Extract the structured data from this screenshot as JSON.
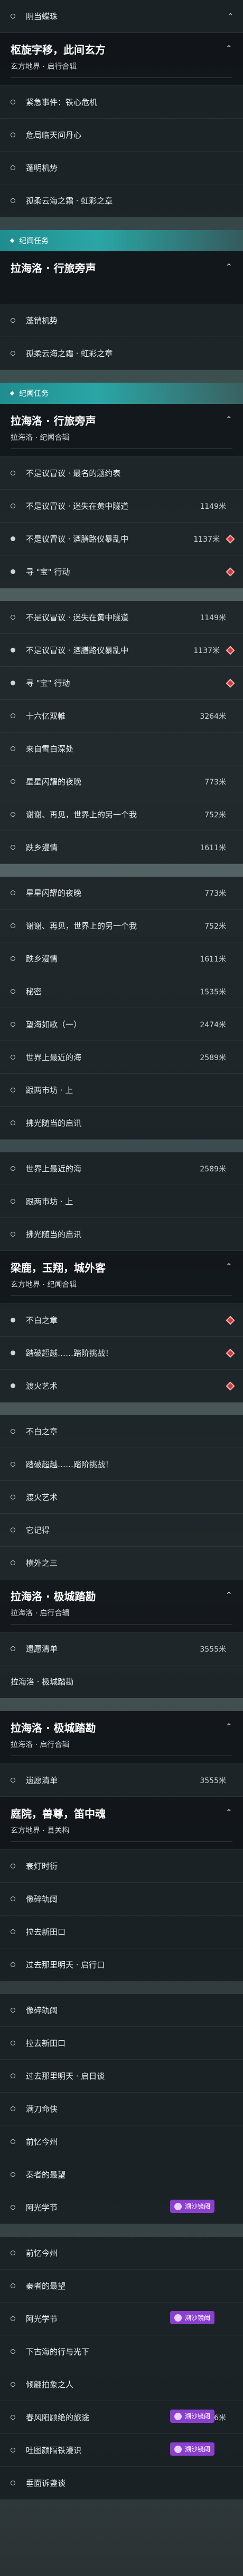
{
  "colors": {
    "accent": "#2aa6a6",
    "badge": "#8b3fd1",
    "marker_red": "#d23a3a"
  },
  "section1": {
    "rows": [
      {
        "label": "阴当蝶珠",
        "icon": "dot",
        "chevron": "collapse"
      }
    ],
    "header": {
      "title": "枢旋字移，此间玄方",
      "sub": "玄方地界 · 启行合辑"
    },
    "rows2": [
      {
        "label": "紧急事件：铁心危机",
        "icon": "dot"
      },
      {
        "label": "危局临天问丹心",
        "icon": "dot"
      },
      {
        "label": "蓬明机势",
        "icon": "dot"
      },
      {
        "label": "孤柔云海之霜 · 虹彩之章",
        "icon": "dot"
      }
    ]
  },
  "tag1": "纪闻任务",
  "section2": {
    "header": {
      "title": "拉海洛 · 行旅旁声",
      "sub": ""
    },
    "rows": [
      {
        "label": "蓬销机势",
        "icon": "dot"
      },
      {
        "label": "孤柔云海之霜 · 虹彩之章",
        "icon": "dot"
      }
    ]
  },
  "tag2": "纪闻任务",
  "section3": {
    "header": {
      "title": "拉海洛 · 行旅旁声",
      "sub": "拉海洛 · 纪闻合辑"
    },
    "rows": [
      {
        "label": "不是议冒议 · 最名的题约表",
        "icon": "dot",
        "dist": "",
        "red": false
      },
      {
        "label": "不是议冒议 · 迷失在黄中隧道",
        "icon": "dot",
        "dist": "1149米",
        "red": false
      },
      {
        "label": "不是议冒议 · 酒膳路仪暴乱中",
        "icon": "dot",
        "dist": "1137米",
        "red": true
      },
      {
        "label": "寻 \"宝\" 行动",
        "icon": "dot",
        "dist": "",
        "red": true
      }
    ]
  },
  "section4": {
    "rows": [
      {
        "label": "不是议冒议 · 迷失在黄中隧道",
        "icon": "dot",
        "dist": "1149米",
        "red": false
      },
      {
        "label": "不是议冒议 · 酒膳路仪暴乱中",
        "icon": "dot",
        "dist": "1137米",
        "red": true
      },
      {
        "label": "寻 \"宝\" 行动",
        "icon": "dot",
        "dist": "",
        "red": true
      },
      {
        "label": "十六亿双帷",
        "icon": "dot",
        "dist": "3264米",
        "red": false
      },
      {
        "label": "来自雪白深处",
        "icon": "dot",
        "dist": "",
        "red": false
      },
      {
        "label": "星星闪耀的夜晚",
        "icon": "dot",
        "dist": "773米",
        "red": false
      },
      {
        "label": "谢谢、再见，世界上的另一个我",
        "icon": "dot",
        "dist": "752米",
        "red": false
      },
      {
        "label": "跌乡漫情",
        "icon": "dot",
        "dist": "1611米",
        "red": false
      }
    ]
  },
  "section5": {
    "rows": [
      {
        "label": "星星闪耀的夜晚",
        "icon": "dot",
        "dist": "773米"
      },
      {
        "label": "谢谢、再见，世界上的另一个我",
        "icon": "dot",
        "dist": "752米"
      },
      {
        "label": "跌乡漫情",
        "icon": "dot",
        "dist": "1611米"
      },
      {
        "label": "秘密",
        "icon": "dot",
        "dist": "1535米"
      },
      {
        "label": "望海如歌（一）",
        "icon": "dot",
        "dist": "2474米"
      },
      {
        "label": "世界上最近的海",
        "icon": "dot",
        "dist": "2589米"
      },
      {
        "label": "跟两市坊 · 上",
        "icon": "dot",
        "dist": ""
      },
      {
        "label": "拂光随当的启讯",
        "icon": "dot",
        "dist": ""
      }
    ]
  },
  "section6": {
    "rows": [
      {
        "label": "世界上最近的海",
        "icon": "dot",
        "dist": "2589米"
      },
      {
        "label": "跟两市坊 · 上",
        "icon": "dot",
        "dist": ""
      },
      {
        "label": "拂光随当的启讯",
        "icon": "dot",
        "dist": ""
      }
    ],
    "header": {
      "title": "梁鹿，玉翔，城外客",
      "sub": "玄方地界 · 纪闻合辑"
    },
    "rows2": [
      {
        "label": "不白之章",
        "icon": "dot",
        "red": true
      },
      {
        "label": "踏破超越……踏阶挑战！",
        "icon": "dot",
        "red": true
      },
      {
        "label": "渡火艺术",
        "icon": "dot",
        "red": true
      }
    ]
  },
  "section7": {
    "rows": [
      {
        "label": "不白之章",
        "icon": "dot"
      },
      {
        "label": "踏破超越……踏阶挑战！",
        "icon": "dot"
      },
      {
        "label": "渡火艺术",
        "icon": "dot"
      },
      {
        "label": "它记得",
        "icon": "dot"
      },
      {
        "label": "横外之三",
        "icon": "dot"
      }
    ],
    "header": {
      "title": "拉海洛 · 极城踏勘",
      "sub": "拉海洛 · 启行合辑"
    },
    "rows2": [
      {
        "label": "遗愿清单",
        "icon": "dot",
        "dist": "3555米"
      }
    ],
    "cut_header": "拉海洛 · 极城踏勘"
  },
  "section8": {
    "header": {
      "title": "拉海洛 · 极城踏勘",
      "sub": "拉海洛 · 启行合辑"
    },
    "rows": [
      {
        "label": "遗愿清单",
        "icon": "dot",
        "dist": "3555米"
      }
    ],
    "header2": {
      "title": "庭院，兽尊，笛中魂",
      "sub": "玄方地界 · 县关构"
    },
    "rows2": [
      {
        "label": "衰灯时衍",
        "icon": "dot",
        "badge": ""
      },
      {
        "label": "像碎轨阔",
        "icon": "dot",
        "badge": ""
      },
      {
        "label": "拉去新田口",
        "icon": "dot",
        "badge": ""
      },
      {
        "label": "过去那里明天 · 启行口",
        "icon": "dot",
        "badge": ""
      }
    ]
  },
  "section9": {
    "rows": [
      {
        "label": "像碎轨阔",
        "icon": "dot",
        "badge": ""
      },
      {
        "label": "拉去新田口",
        "icon": "dot",
        "badge": ""
      },
      {
        "label": "过去那里明天 · 启日谈",
        "icon": "dot",
        "badge": ""
      },
      {
        "label": "满刀命侠",
        "icon": "dot",
        "badge": ""
      },
      {
        "label": "前忆今州",
        "icon": "dot",
        "badge": ""
      },
      {
        "label": "秦者的最望",
        "icon": "dot",
        "badge": ""
      },
      {
        "label": "阿光学节",
        "icon": "dot",
        "badge": "溯沙镜阈"
      }
    ]
  },
  "section10": {
    "rows": [
      {
        "label": "前忆今州",
        "icon": "dot",
        "badge": "",
        "dist": ""
      },
      {
        "label": "秦者的最望",
        "icon": "dot",
        "badge": "",
        "dist": ""
      },
      {
        "label": "阿光学节",
        "icon": "dot",
        "badge": "溯沙镜阈",
        "dist": ""
      },
      {
        "label": "下古海的行与光下",
        "icon": "dot",
        "badge": "",
        "dist": ""
      },
      {
        "label": "倾翩拍象之人",
        "icon": "dot",
        "badge": "",
        "dist": ""
      },
      {
        "label": "春风阳顾绝的旅途",
        "icon": "dot",
        "badge": "溯沙镜阈",
        "dist": "666米"
      },
      {
        "label": "吐图颜隔铁漫识",
        "icon": "dot",
        "badge": "溯沙镜阈",
        "dist": ""
      },
      {
        "label": "垂面诉盏谈",
        "icon": "dot",
        "badge": "",
        "dist": ""
      }
    ]
  }
}
